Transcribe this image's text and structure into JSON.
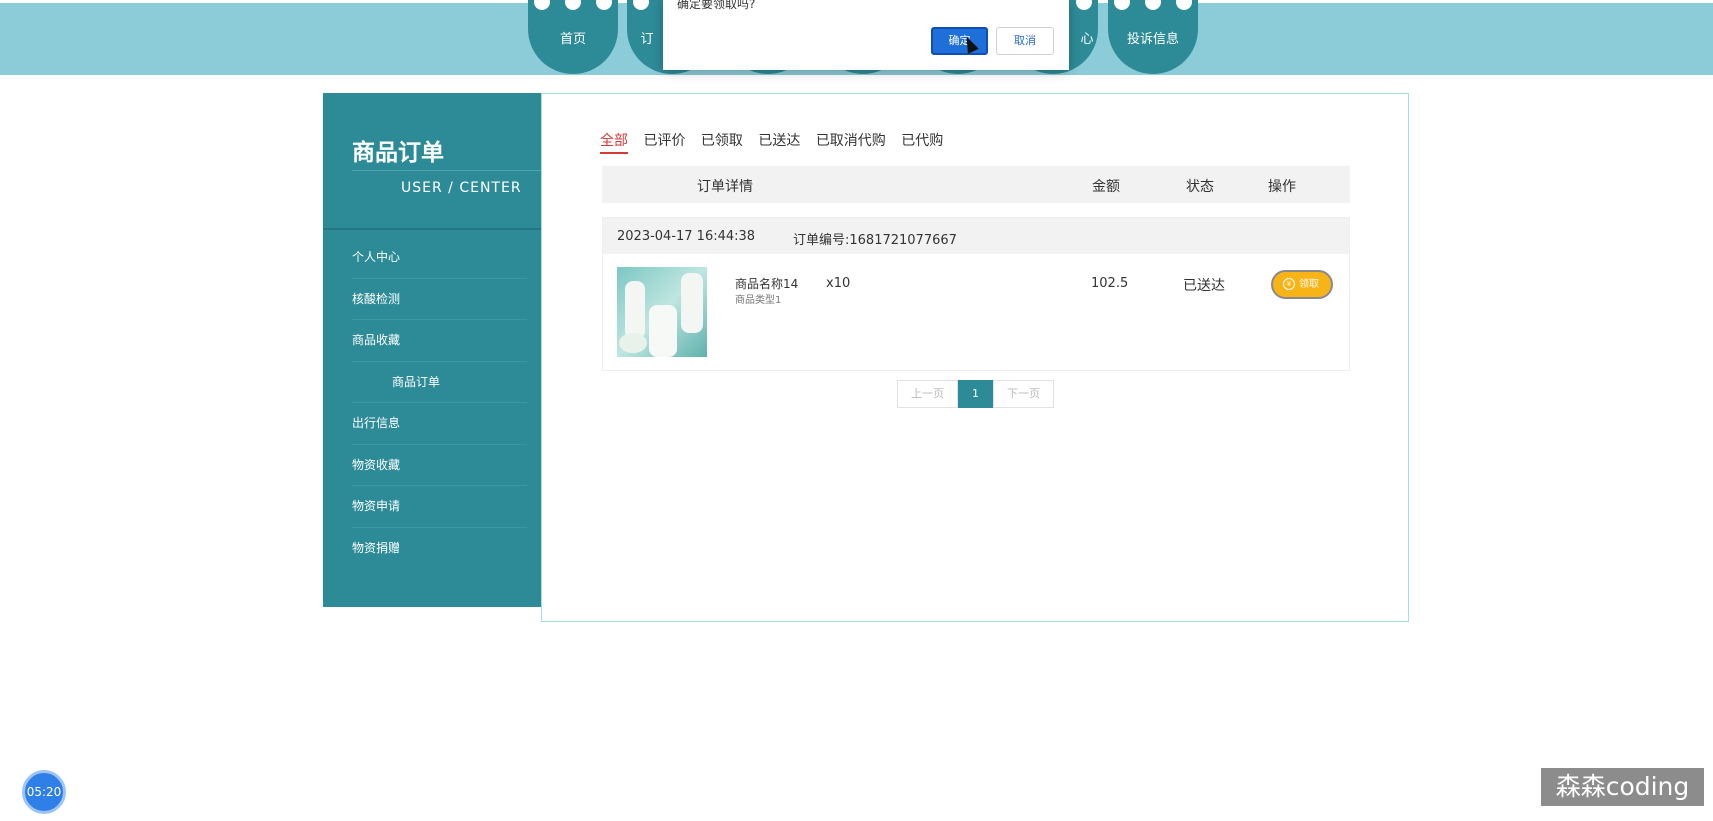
{
  "nav": {
    "home": "首页",
    "partial_left": "订",
    "partial_right": "心",
    "complaint": "投诉信息"
  },
  "dialog": {
    "message": "确定要领取吗?",
    "ok": "确定",
    "cancel": "取消"
  },
  "sidebar": {
    "title": "商品订单",
    "subtitle": "USER / CENTER",
    "items": [
      {
        "label": "个人中心"
      },
      {
        "label": "核酸检测"
      },
      {
        "label": "商品收藏"
      },
      {
        "label": "商品订单"
      },
      {
        "label": "出行信息"
      },
      {
        "label": "物资收藏"
      },
      {
        "label": "物资申请"
      },
      {
        "label": "物资捐赠"
      }
    ]
  },
  "tabs": [
    "全部",
    "已评价",
    "已领取",
    "已送达",
    "已取消代购",
    "已代购"
  ],
  "table": {
    "headers": {
      "detail": "订单详情",
      "amount": "金额",
      "status": "状态",
      "action": "操作"
    }
  },
  "order": {
    "time": "2023-04-17 16:44:38",
    "number": "订单编号:1681721077667",
    "product_name": "商品名称14",
    "product_type": "商品类型1",
    "quantity": "x10",
    "amount": "102.5",
    "status": "已送达",
    "action_label": "领取",
    "action_icon": "¥"
  },
  "pager": {
    "prev": "上一页",
    "current": "1",
    "next": "下一页"
  },
  "timer": "05:20",
  "watermark": "森森coding"
}
